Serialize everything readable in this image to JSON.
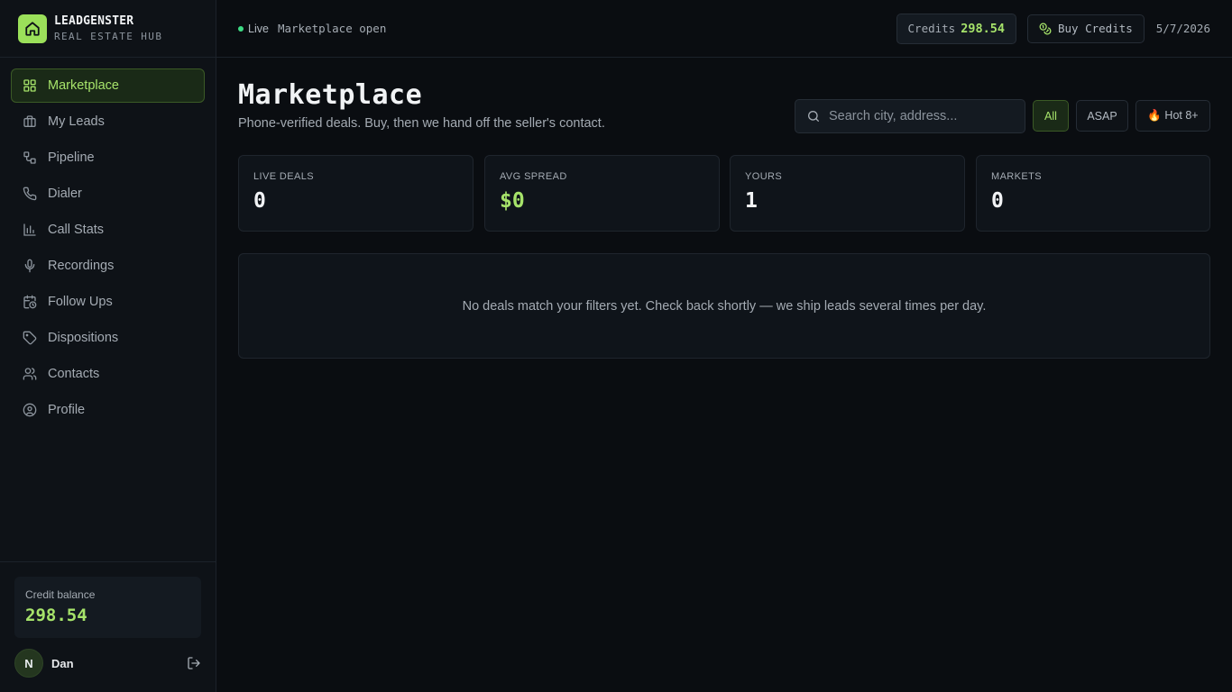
{
  "brand": {
    "name": "LEADGENSTER",
    "subtitle": "REAL ESTATE HUB"
  },
  "sidebar": {
    "items": [
      {
        "label": "Marketplace",
        "icon": "grid-icon",
        "active": true
      },
      {
        "label": "My Leads",
        "icon": "briefcase-icon"
      },
      {
        "label": "Pipeline",
        "icon": "workflow-icon"
      },
      {
        "label": "Dialer",
        "icon": "phone-icon"
      },
      {
        "label": "Call Stats",
        "icon": "bar-chart-icon"
      },
      {
        "label": "Recordings",
        "icon": "microphone-icon"
      },
      {
        "label": "Follow Ups",
        "icon": "calendar-clock-icon"
      },
      {
        "label": "Dispositions",
        "icon": "tag-icon"
      },
      {
        "label": "Contacts",
        "icon": "users-icon"
      },
      {
        "label": "Profile",
        "icon": "user-circle-icon"
      }
    ],
    "credit_balance": {
      "label": "Credit balance",
      "value": "298.54"
    },
    "user": {
      "initial": "N",
      "name": "Dan"
    }
  },
  "topbar": {
    "live_label": "Live",
    "status": "Marketplace open",
    "credits_label": "Credits",
    "credits_value": "298.54",
    "buy_label": "Buy Credits",
    "date": "5/7/2026"
  },
  "main": {
    "title": "Marketplace",
    "subtitle": "Phone-verified deals. Buy, then we hand off the seller's contact.",
    "search": {
      "placeholder": "Search city, address...",
      "value": ""
    },
    "filters": [
      {
        "label": "All",
        "active": true
      },
      {
        "label": "ASAP"
      },
      {
        "label": "🔥 Hot 8+"
      }
    ],
    "stats": [
      {
        "label": "LIVE DEALS",
        "value": "0"
      },
      {
        "label": "AVG SPREAD",
        "value": "$0"
      },
      {
        "label": "YOURS",
        "value": "1"
      },
      {
        "label": "MARKETS",
        "value": "0"
      }
    ],
    "empty_message": "No deals match your filters yet. Check back shortly — we ship leads several times per day."
  },
  "colors": {
    "accent": "#a6e36a",
    "background": "#0a0d11",
    "sidebar": "#0e1217",
    "live": "#3ddc84"
  }
}
